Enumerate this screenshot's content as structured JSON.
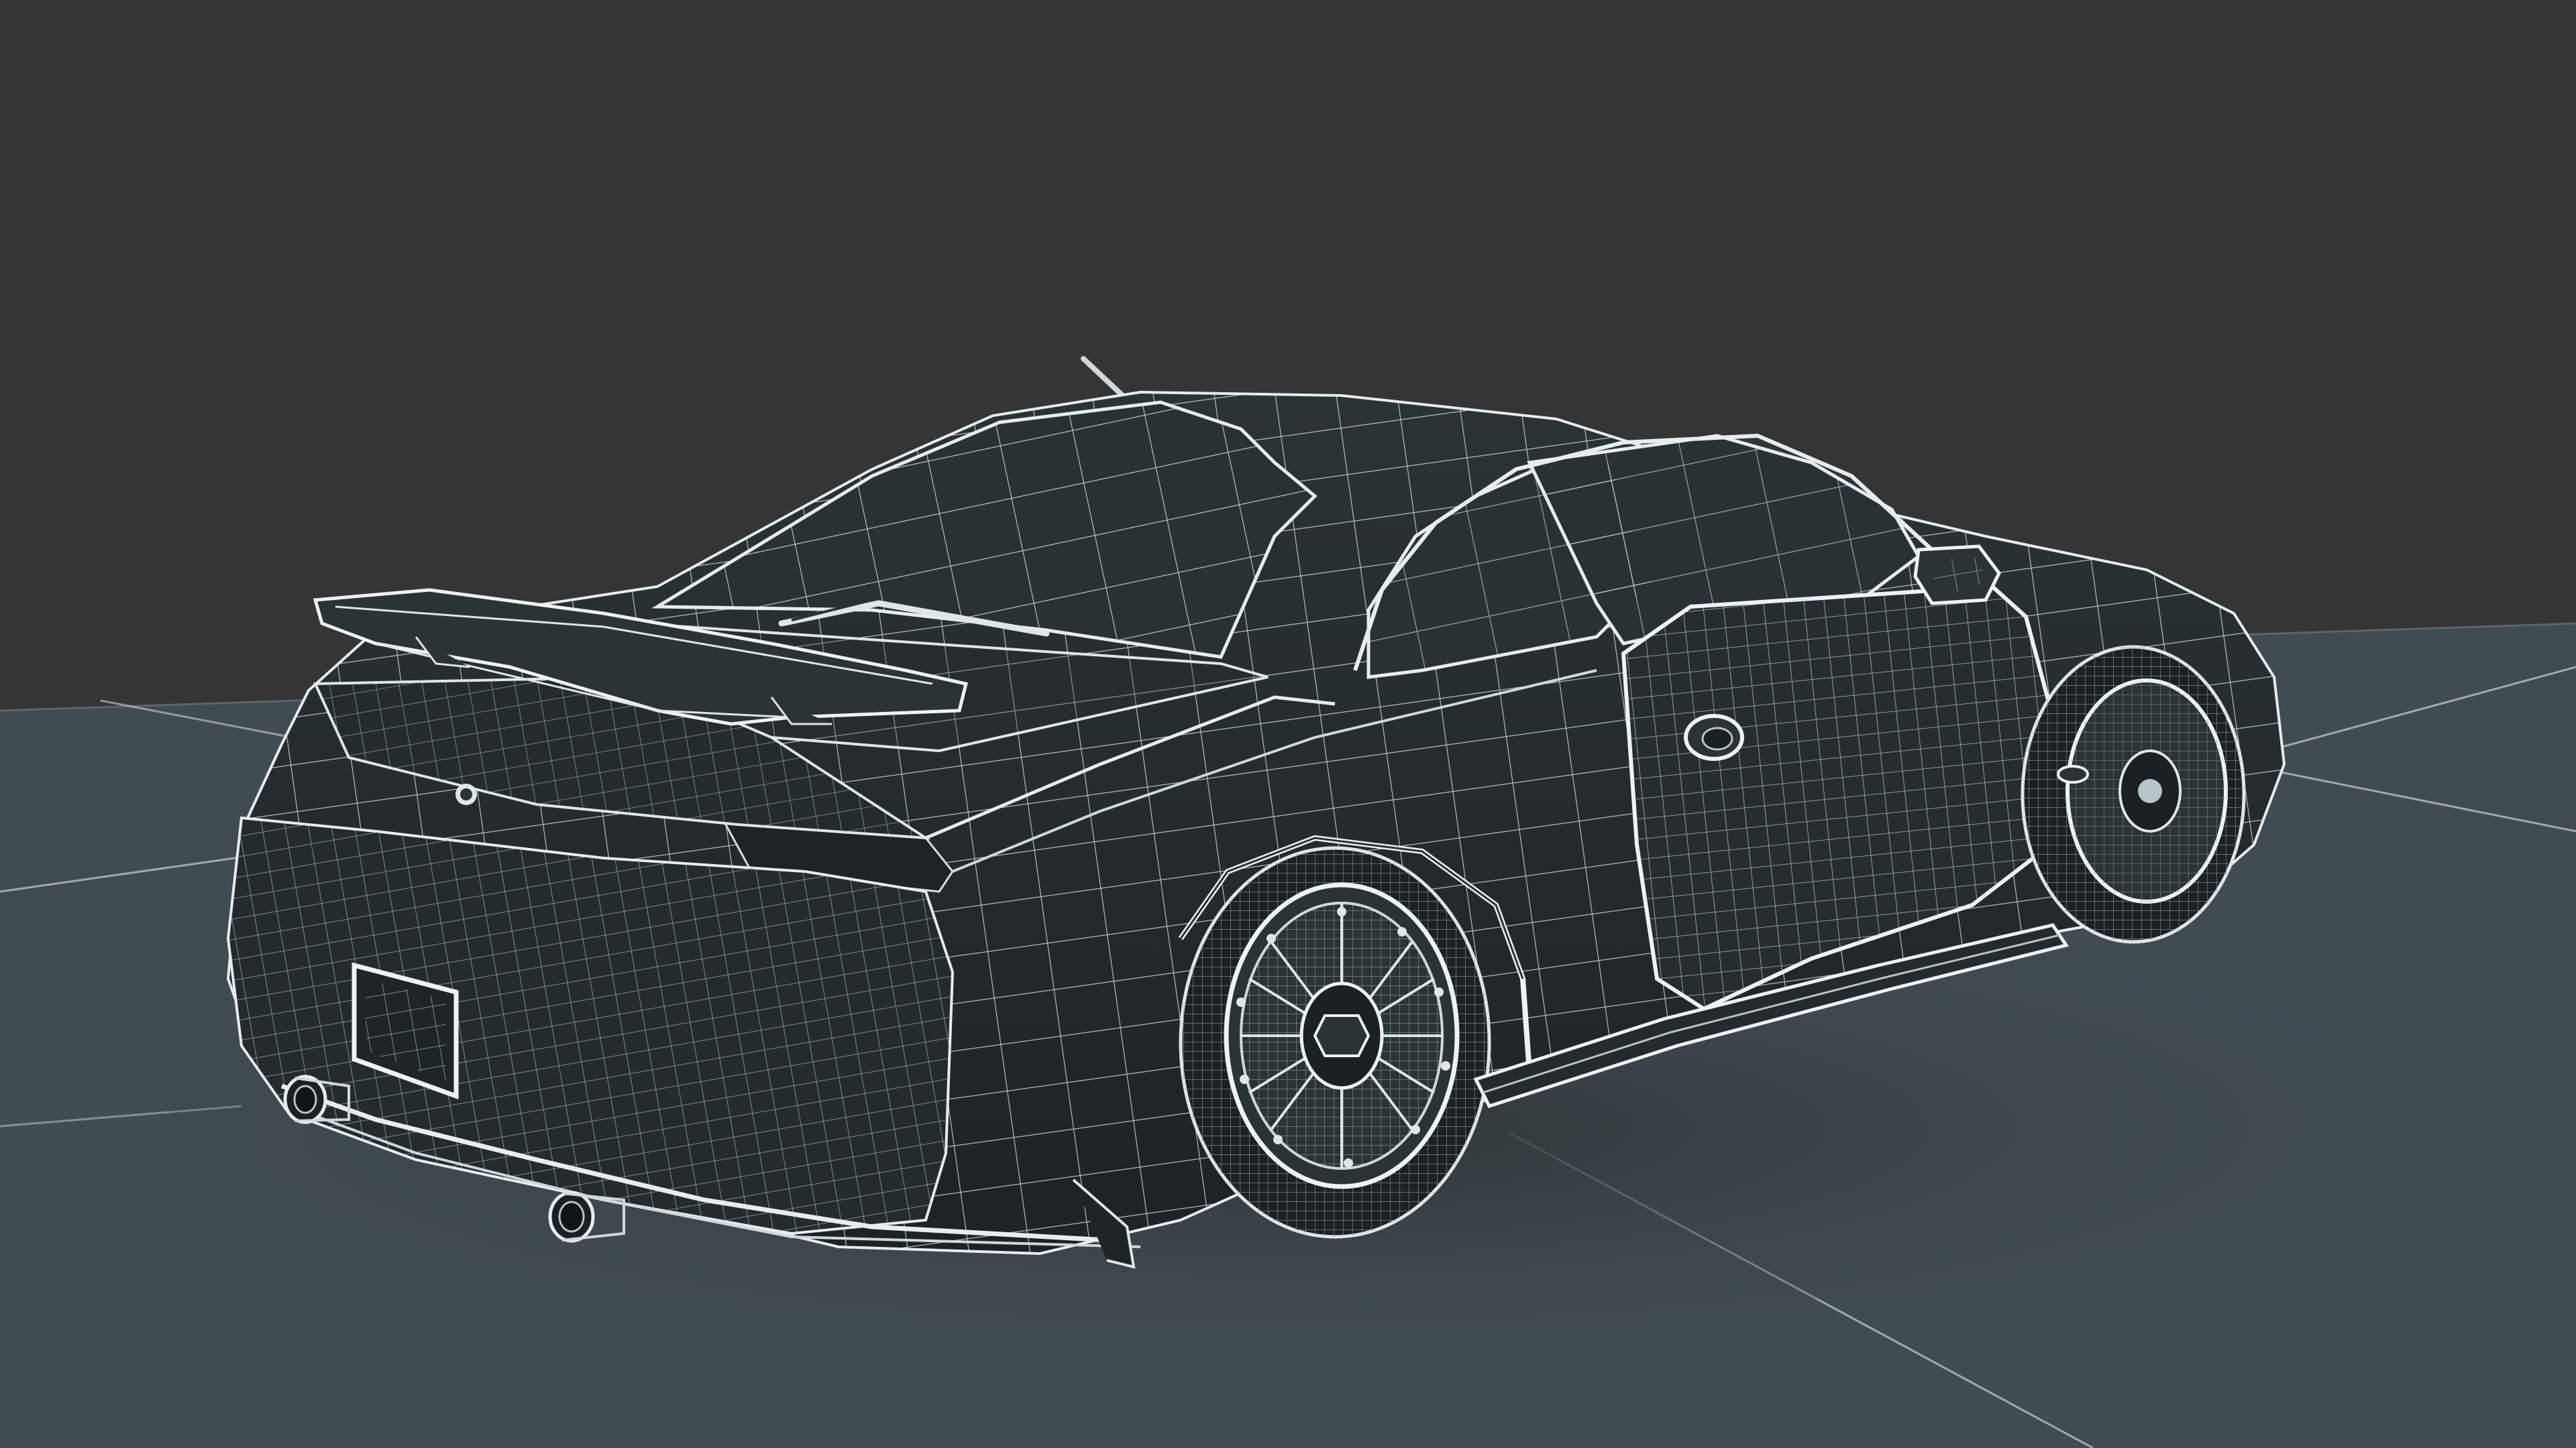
{
  "scene": {
    "colors": {
      "background": "#353535",
      "ground": "#414b52",
      "ground_line": "#c9d2d8",
      "body_fill": "#222a2d",
      "body_shade": "#1a2023",
      "glass_fill": "#283236",
      "wire_major": "#e6ecef",
      "wire_minor": "#9aa7ad",
      "tire_fill": "#1b2124"
    },
    "objects": [
      {
        "name": "ground-plane"
      },
      {
        "name": "car-body-wireframe"
      },
      {
        "name": "rear-spoiler"
      },
      {
        "name": "rear-bumper"
      },
      {
        "name": "license-plate"
      },
      {
        "name": "exhaust-pipe-left"
      },
      {
        "name": "exhaust-pipe-right"
      },
      {
        "name": "rear-wheel"
      },
      {
        "name": "front-wheel"
      },
      {
        "name": "side-mirror"
      },
      {
        "name": "roof-antenna"
      },
      {
        "name": "door-panel"
      },
      {
        "name": "door-handle"
      },
      {
        "name": "rear-wiper"
      },
      {
        "name": "rear-emblem"
      }
    ]
  }
}
